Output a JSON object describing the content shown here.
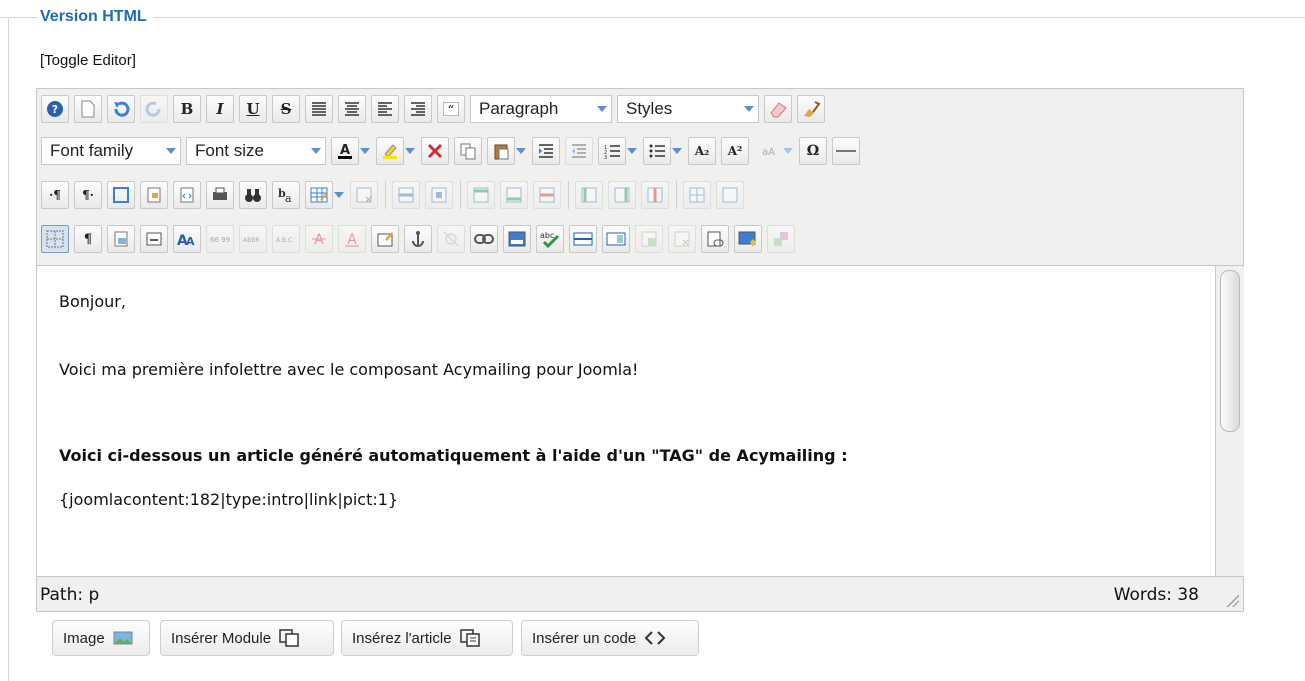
{
  "fieldset": {
    "legend": "Version HTML",
    "toggle_label": "[Toggle Editor]"
  },
  "toolbar": {
    "format_select": "Paragraph",
    "styles_select": "Styles",
    "font_family_select": "Font family",
    "font_size_select": "Font size",
    "bold": "B",
    "italic": "I",
    "underline": "U",
    "strike": "S",
    "subscript": "A₂",
    "superscript": "A²",
    "omega": "Ω",
    "pilcrow": "¶",
    "ltr": "·¶",
    "rtl": "¶·"
  },
  "content": {
    "line1": "Bonjour,",
    "line2": "Voici ma première infolettre avec le composant Acymailing pour Joomla!",
    "line3": "Voici ci-dessous un article généré automatiquement à l'aide d'un \"TAG\" de Acymailing :",
    "line4": "{joomlacontent:182|type:intro|link|pict:1}"
  },
  "status": {
    "path": "Path: p",
    "words": "Words: 38"
  },
  "buttons": {
    "image": "Image",
    "module": "Insérer Module",
    "article": "Insérez l'article",
    "code": "Insérer un code"
  },
  "colors": {
    "legend": "#1e6bb8",
    "accent_arrow": "#5b8fd0"
  }
}
